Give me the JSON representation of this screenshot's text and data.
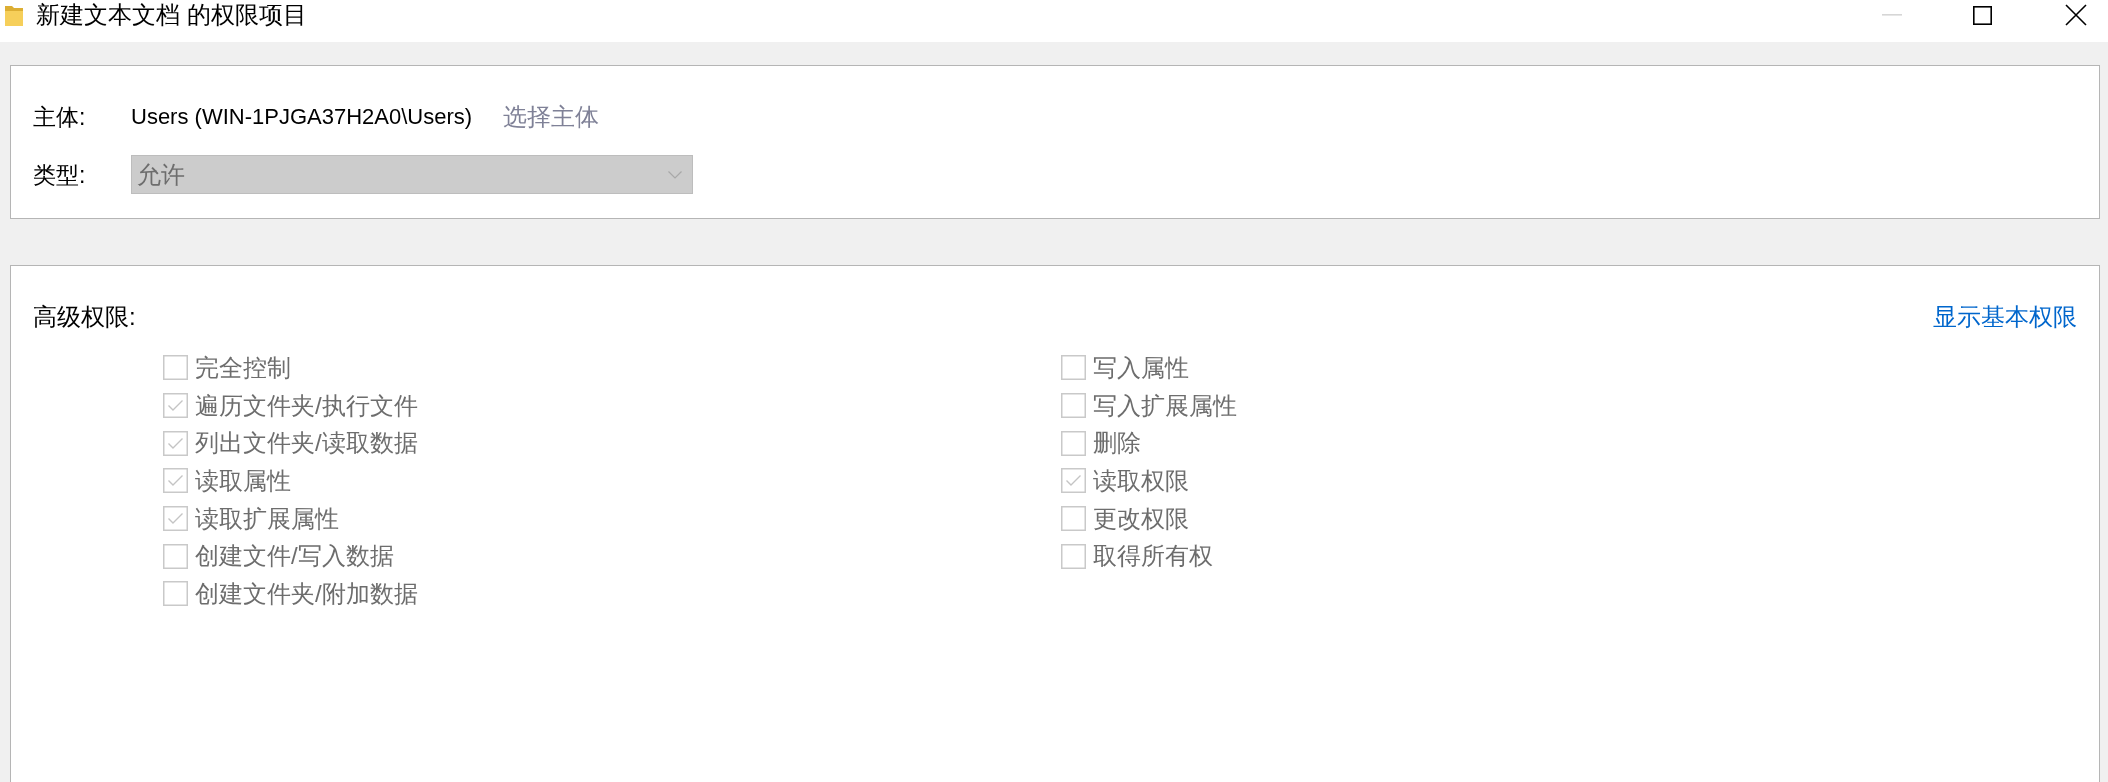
{
  "window": {
    "title": "新建文本文档 的权限项目",
    "buttons": [
      {
        "kind": "minimize",
        "disabled": true
      },
      {
        "kind": "maximize",
        "disabled": false
      },
      {
        "kind": "close",
        "disabled": false
      }
    ]
  },
  "principal": {
    "label": "主体:",
    "value": "Users (WIN-1PJGA37H2A0\\Users)",
    "link": {
      "text": "选择主体",
      "disabled": true
    }
  },
  "type_field": {
    "label": "类型:",
    "value": "允许",
    "disabled": true
  },
  "advanced_permissions": {
    "label": "高级权限:",
    "link": "显示基本权限",
    "columns": [
      {
        "items": [
          {
            "label": "完全控制",
            "checked": false,
            "disabled": true
          },
          {
            "label": "遍历文件夹/执行文件",
            "checked": true,
            "disabled": true
          },
          {
            "label": "列出文件夹/读取数据",
            "checked": true,
            "disabled": true
          },
          {
            "label": "读取属性",
            "checked": true,
            "disabled": true
          },
          {
            "label": "读取扩展属性",
            "checked": true,
            "disabled": true
          },
          {
            "label": "创建文件/写入数据",
            "checked": false,
            "disabled": true
          },
          {
            "label": "创建文件夹/附加数据",
            "checked": false,
            "disabled": true
          }
        ]
      },
      {
        "items": [
          {
            "label": "写入属性",
            "checked": false,
            "disabled": true
          },
          {
            "label": "写入扩展属性",
            "checked": false,
            "disabled": true
          },
          {
            "label": "删除",
            "checked": false,
            "disabled": true
          },
          {
            "label": "读取权限",
            "checked": true,
            "disabled": true
          },
          {
            "label": "更改权限",
            "checked": false,
            "disabled": true
          },
          {
            "label": "取得所有权",
            "checked": false,
            "disabled": true
          }
        ]
      }
    ]
  }
}
